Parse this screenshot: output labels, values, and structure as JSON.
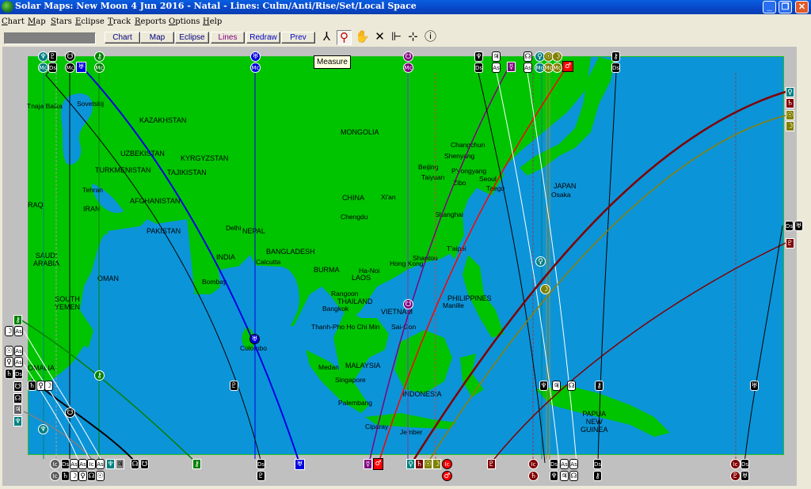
{
  "window": {
    "title": "Solar Maps: New Moon 4 Jun 2016 - Natal - Lines: Culm/Anti/Rise/Set/Local Space",
    "controls": [
      "minimize",
      "restore",
      "close"
    ]
  },
  "menu": [
    "Chart",
    "Map",
    "Stars",
    "Eclipse",
    "Track",
    "Reports",
    "Options",
    "Help"
  ],
  "toolbar": {
    "status_field": "",
    "buttons": [
      {
        "label": "Chart",
        "color": "#000080"
      },
      {
        "label": "Map",
        "color": "#000080"
      },
      {
        "label": "Eclipse",
        "color": "#000080"
      },
      {
        "label": "Lines",
        "color": "#800080"
      },
      {
        "label": "Redraw",
        "color": "#0000c0"
      },
      {
        "label": "Prev",
        "color": "#0000c0"
      }
    ],
    "tools": [
      {
        "name": "compass-tool",
        "glyph": "⅄",
        "active": false
      },
      {
        "name": "measure-tool",
        "glyph": "🔍",
        "active": true
      },
      {
        "name": "pan-tool",
        "glyph": "✋",
        "active": false
      },
      {
        "name": "zoom-extent-tool",
        "glyph": "✕",
        "active": false
      },
      {
        "name": "line-tool",
        "glyph": "⊩",
        "active": false
      },
      {
        "name": "crosshair-tool",
        "glyph": "⊹",
        "active": false
      },
      {
        "name": "info-tool",
        "glyph": "ⓘ",
        "active": false
      }
    ],
    "tooltip": "Measure"
  },
  "map": {
    "land_color": "#00c400",
    "sea_color": "#0c94d8",
    "countries": [
      {
        "name": "KAZAKHSTAN"
      },
      {
        "name": "MONGOLIA"
      },
      {
        "name": "UZBEKISTAN"
      },
      {
        "name": "KYRGYZSTAN"
      },
      {
        "name": "TURKMENISTAN"
      },
      {
        "name": "TAJIKISTAN"
      },
      {
        "name": "AFGHANISTAN"
      },
      {
        "name": "IRAN"
      },
      {
        "name": "RAQ"
      },
      {
        "name": "PAKISTAN"
      },
      {
        "name": "NEPAL"
      },
      {
        "name": "INDIA"
      },
      {
        "name": "CHINA"
      },
      {
        "name": "BANGLADESH"
      },
      {
        "name": "SAUDI\nARABIA"
      },
      {
        "name": "OMAN"
      },
      {
        "name": "SOUTH\nYEMEN"
      },
      {
        "name": "BURMA"
      },
      {
        "name": "LAOS"
      },
      {
        "name": "THAILAND"
      },
      {
        "name": "VIETNAM"
      },
      {
        "name": "PHILIPPINES"
      },
      {
        "name": "MALAYSIA"
      },
      {
        "name": "INDONESIA"
      },
      {
        "name": "JAPAN"
      },
      {
        "name": "PAPUA\nNEW\nGUINEA"
      },
      {
        "name": "OMALIA"
      }
    ],
    "cities": [
      "Tnaja Baika",
      "Sovetskij",
      "Tehran",
      "Delhi",
      "Bombay",
      "Calcutta",
      "Colombo",
      "Changchun",
      "Shenyang",
      "Beijing",
      "Taiyuan",
      "P'yongyang",
      "Zibo",
      "Seoul",
      "Taegu",
      "Xi'an",
      "Chengdu",
      "Shanghai",
      "Osaka",
      "T'aipei",
      "Shantou",
      "Hong Kong",
      "Ha-Noi",
      "Rangoon",
      "Bangkok",
      "Manille",
      "Thanh-Pho Ho Chi Min",
      "Sai-Gon",
      "Medan",
      "Singapore",
      "Palembang",
      "Ciparay",
      "Jember"
    ]
  },
  "planet_colors": {
    "neptune": "#008080",
    "pluto": "#000000",
    "node": "#000000",
    "chiron": "#008000",
    "uranus": "#0000e0",
    "mercury": "#800080",
    "jupiter": "#ffffff",
    "venus": "#008080",
    "sun": "#808000",
    "moon": "#808000",
    "mars": "#ff0000",
    "saturn": "#800000",
    "pluto_red": "#800000"
  },
  "top_markers": [
    {
      "id": "neptune-mc",
      "planet": "Neptune",
      "glyphs": [
        "♆",
        "Mc"
      ]
    },
    {
      "id": "pluto-ds",
      "planet": "Pluto",
      "glyphs": [
        "♇",
        "Ds"
      ]
    },
    {
      "id": "node-mc",
      "planet": "South Node",
      "glyphs": [
        "☋",
        "Mc"
      ]
    },
    {
      "id": "uranus-square",
      "planet": "Uranus",
      "glyphs": [
        "♅"
      ]
    },
    {
      "id": "chiron-mc",
      "planet": "Chiron",
      "glyphs": [
        "⚷",
        "Mc"
      ]
    },
    {
      "id": "uranus-mc",
      "planet": "Uranus",
      "glyphs": [
        "♅",
        "Mc"
      ]
    },
    {
      "id": "node-mc-purple",
      "planet": "Node",
      "glyphs": [
        "☋",
        "Mc"
      ]
    },
    {
      "id": "neptune-ds",
      "planet": "Neptune",
      "glyphs": [
        "♆",
        "Ds"
      ]
    },
    {
      "id": "jupiter-as",
      "planet": "Jupiter",
      "glyphs": [
        "♃",
        "As"
      ]
    },
    {
      "id": "mercury",
      "planet": "Mercury",
      "glyphs": [
        "☿"
      ]
    },
    {
      "id": "node-as",
      "planet": "Node",
      "glyphs": [
        "☊",
        "As"
      ]
    },
    {
      "id": "venus-mc",
      "planet": "Venus",
      "glyphs": [
        "♀",
        "Mc"
      ]
    },
    {
      "id": "sun-mc",
      "planet": "Sun",
      "glyphs": [
        "☉",
        "Mc"
      ]
    },
    {
      "id": "moon-mc",
      "planet": "Moon",
      "glyphs": [
        "☽",
        "Mc"
      ]
    },
    {
      "id": "mars",
      "planet": "Mars",
      "glyphs": [
        "♂"
      ]
    },
    {
      "id": "chiron-ds",
      "planet": "Chiron",
      "glyphs": [
        "⚷",
        "Ds"
      ]
    }
  ],
  "right_markers": [
    {
      "id": "venus-right",
      "glyph": "♀"
    },
    {
      "id": "saturn-right",
      "glyph": "♄"
    },
    {
      "id": "sun-right",
      "glyph": "☉"
    },
    {
      "id": "moon-right",
      "glyph": "☽"
    },
    {
      "id": "uranus-ds-right",
      "glyphs": [
        "Ds",
        "♅"
      ]
    },
    {
      "id": "pluto-right",
      "glyph": "♇"
    }
  ],
  "left_markers": [
    {
      "id": "chiron-left",
      "glyph": "⚷"
    },
    {
      "id": "moon-as-left",
      "glyphs": [
        "☽",
        "As"
      ]
    },
    {
      "id": "sun-as-left",
      "glyphs": [
        "☉",
        "As"
      ]
    },
    {
      "id": "venus-as-left",
      "glyphs": [
        "♀",
        "As"
      ]
    },
    {
      "id": "saturn-ds-left",
      "glyphs": [
        "♄",
        "Ds"
      ]
    },
    {
      "id": "cluster-left",
      "glyphs": [
        "♄",
        "♀",
        "☽"
      ]
    },
    {
      "id": "node-left",
      "glyph": "☋"
    },
    {
      "id": "northnode-left",
      "glyph": "☊"
    },
    {
      "id": "jupiter-left",
      "glyph": "♃"
    },
    {
      "id": "neptune-left",
      "glyph": "♆"
    }
  ],
  "bottom_markers": [
    {
      "id": "b1",
      "glyphs": [
        "Ic",
        "Ic"
      ]
    },
    {
      "id": "b2",
      "glyphs": [
        "Ds",
        "♄"
      ]
    },
    {
      "id": "b3",
      "glyphs": [
        "As",
        "☽"
      ]
    },
    {
      "id": "b4",
      "glyphs": [
        "As",
        "♀"
      ]
    },
    {
      "id": "b5",
      "glyphs": [
        "Ic",
        "☊"
      ]
    },
    {
      "id": "b6",
      "glyphs": [
        "As",
        "☉"
      ]
    },
    {
      "id": "b7",
      "glyphs": [
        "♆"
      ]
    },
    {
      "id": "b8",
      "glyphs": [
        "♃"
      ]
    },
    {
      "id": "b9",
      "glyphs": [
        "☊"
      ]
    },
    {
      "id": "b10",
      "glyphs": [
        "☋"
      ]
    },
    {
      "id": "b11",
      "glyphs": [
        "⚷"
      ]
    },
    {
      "id": "b12",
      "glyphs": [
        "Ds",
        "♇"
      ]
    },
    {
      "id": "b13",
      "glyphs": [
        "♅"
      ]
    },
    {
      "id": "b14",
      "glyphs": [
        "☿"
      ]
    },
    {
      "id": "b15",
      "glyphs": [
        "♂"
      ]
    },
    {
      "id": "b16",
      "glyphs": [
        "♀"
      ]
    },
    {
      "id": "b17",
      "glyphs": [
        "♄"
      ]
    },
    {
      "id": "b18",
      "glyphs": [
        "☉"
      ]
    },
    {
      "id": "b19",
      "glyphs": [
        "☽"
      ]
    },
    {
      "id": "b20",
      "glyphs": [
        "Ic",
        "♂"
      ]
    },
    {
      "id": "b21",
      "glyphs": [
        "♇"
      ]
    },
    {
      "id": "b22",
      "glyphs": [
        "Ic",
        "♄"
      ]
    },
    {
      "id": "b23",
      "glyphs": [
        "Ds",
        "♆"
      ]
    },
    {
      "id": "b24",
      "glyphs": [
        "As",
        "♃"
      ]
    },
    {
      "id": "b25",
      "glyphs": [
        "As",
        "☊"
      ]
    },
    {
      "id": "b26",
      "glyphs": [
        "Ds",
        "⚷"
      ]
    },
    {
      "id": "b27",
      "glyphs": [
        "Ic",
        "♇"
      ]
    },
    {
      "id": "b28",
      "glyphs": [
        "Ds",
        "♅"
      ]
    }
  ],
  "map_markers": [
    {
      "id": "uranus-colombo",
      "glyph": "♅"
    },
    {
      "id": "pluto-ocean",
      "glyph": "♇"
    },
    {
      "id": "node-vietnam",
      "glyph": "☋"
    },
    {
      "id": "venus-pacific",
      "glyph": "♀"
    },
    {
      "id": "moon-pacific",
      "glyph": "☽"
    },
    {
      "id": "chiron-somalia",
      "glyph": "⚷"
    },
    {
      "id": "node-arabian",
      "glyph": "☋"
    },
    {
      "id": "neptune-arabian",
      "glyph": "♆"
    },
    {
      "id": "neptune-png",
      "glyph": "♆"
    },
    {
      "id": "jupiter-png",
      "glyph": "♃"
    },
    {
      "id": "node-png",
      "glyph": "☊"
    },
    {
      "id": "chiron-png",
      "glyph": "⚷"
    },
    {
      "id": "uranus-pacific",
      "glyph": "♅"
    }
  ]
}
